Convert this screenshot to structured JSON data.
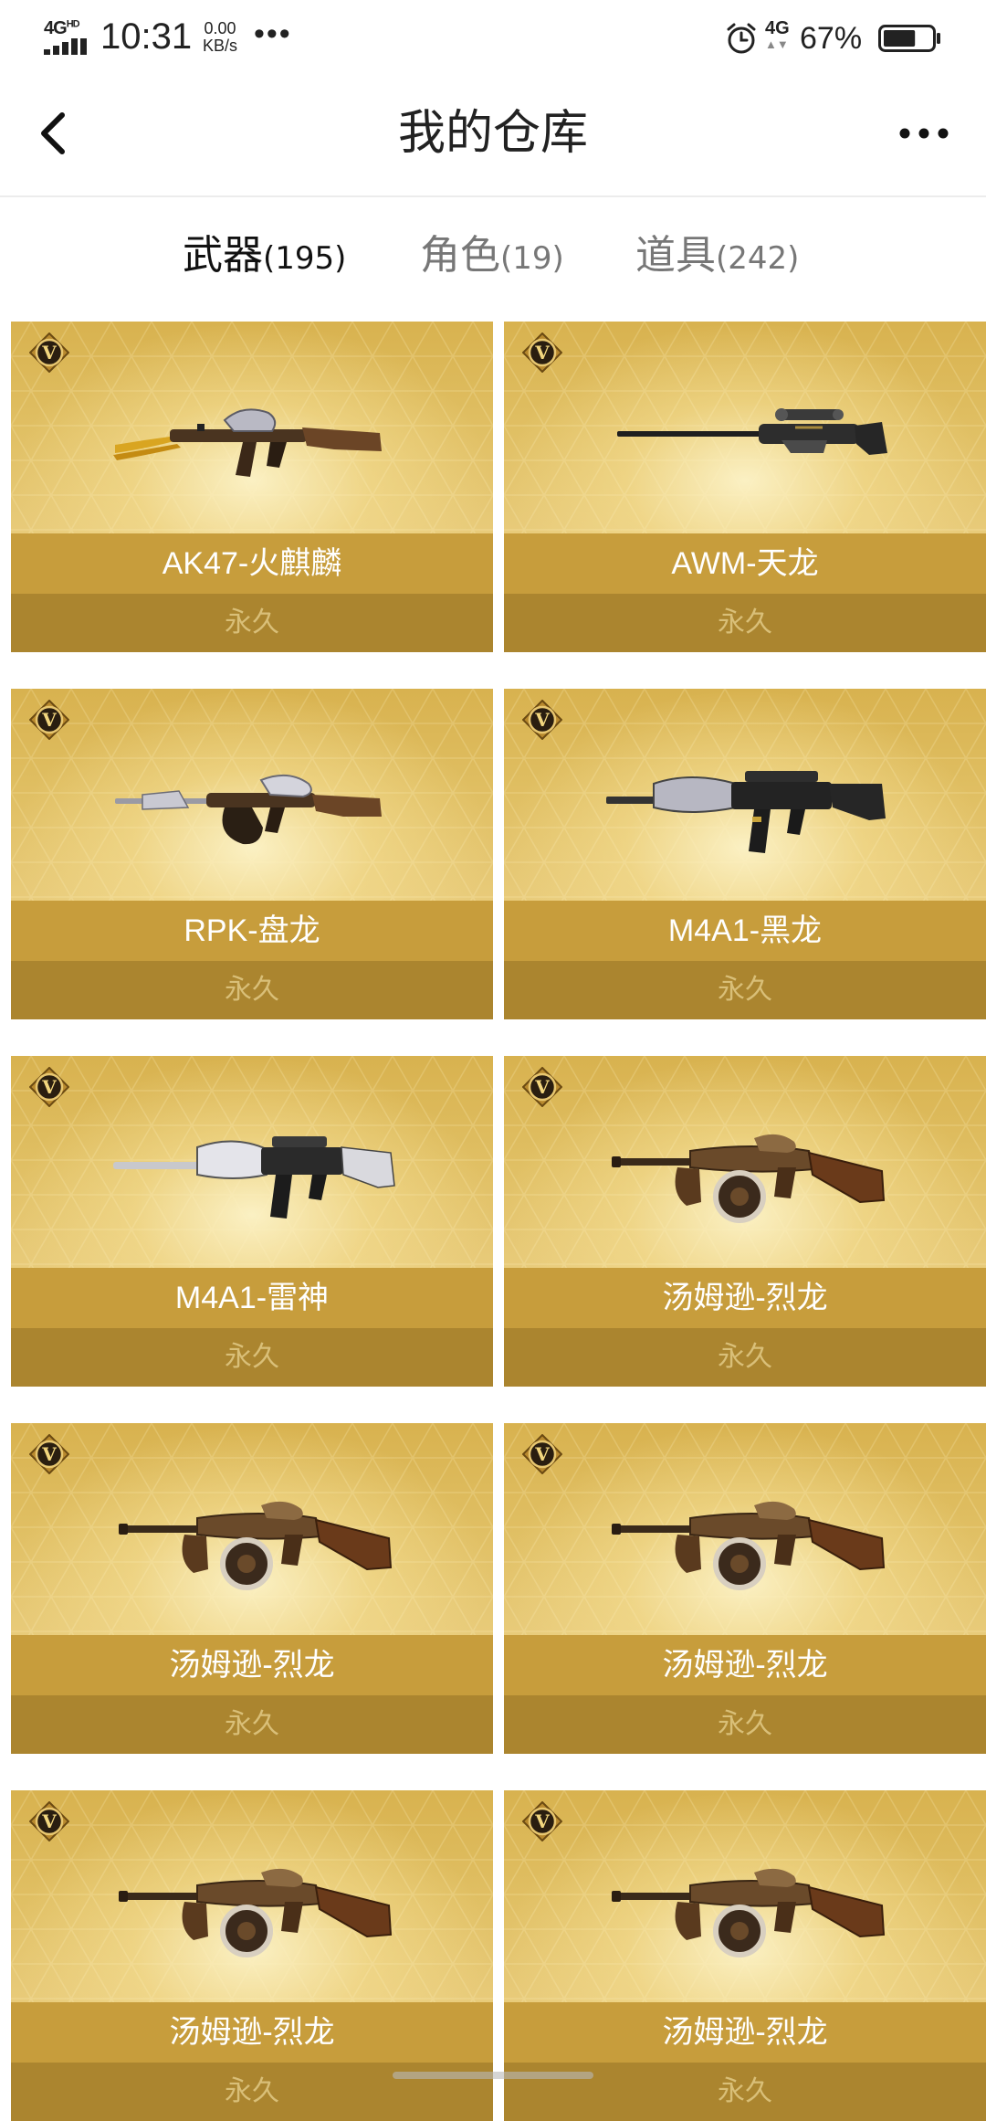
{
  "status_bar": {
    "network_label": "4G",
    "network_sub": "HD",
    "time": "10:31",
    "speed_value": "0.00",
    "speed_unit": "KB/s",
    "dots": "•••",
    "icons": [
      "signal-bars-icon",
      "alarm-clock-icon",
      "battery-icon"
    ],
    "mobile_data_label": "4G",
    "battery_percent": "67%",
    "battery_level": 0.67
  },
  "header": {
    "title": "我的仓库",
    "back_icon": "chevron-left-icon",
    "more_icon": "more-horizontal-icon"
  },
  "tabs": [
    {
      "name": "武器",
      "count": "(195)",
      "active": true
    },
    {
      "name": "角色",
      "count": "(19)",
      "active": false
    },
    {
      "name": "道具",
      "count": "(242)",
      "active": false
    }
  ],
  "colors": {
    "card_gold": "#dcb856",
    "name_bar": "#c79d3c",
    "duration_bar": "#ab852f",
    "duration_text": "#d9bf78"
  },
  "items": [
    {
      "name": "AK47-火麒麟",
      "duration": "永久",
      "weapon": "ak47"
    },
    {
      "name": "AWM-天龙",
      "duration": "永久",
      "weapon": "awm"
    },
    {
      "name": "RPK-盘龙",
      "duration": "永久",
      "weapon": "rpk"
    },
    {
      "name": "M4A1-黑龙",
      "duration": "永久",
      "weapon": "m4a1-dark"
    },
    {
      "name": "M4A1-雷神",
      "duration": "永久",
      "weapon": "m4a1-silver"
    },
    {
      "name": "汤姆逊-烈龙",
      "duration": "永久",
      "weapon": "thompson"
    },
    {
      "name": "汤姆逊-烈龙",
      "duration": "永久",
      "weapon": "thompson"
    },
    {
      "name": "汤姆逊-烈龙",
      "duration": "永久",
      "weapon": "thompson"
    },
    {
      "name": "汤姆逊-烈龙",
      "duration": "永久",
      "weapon": "thompson"
    },
    {
      "name": "汤姆逊-烈龙",
      "duration": "永久",
      "weapon": "thompson"
    }
  ],
  "vip_badge_letter": "V"
}
